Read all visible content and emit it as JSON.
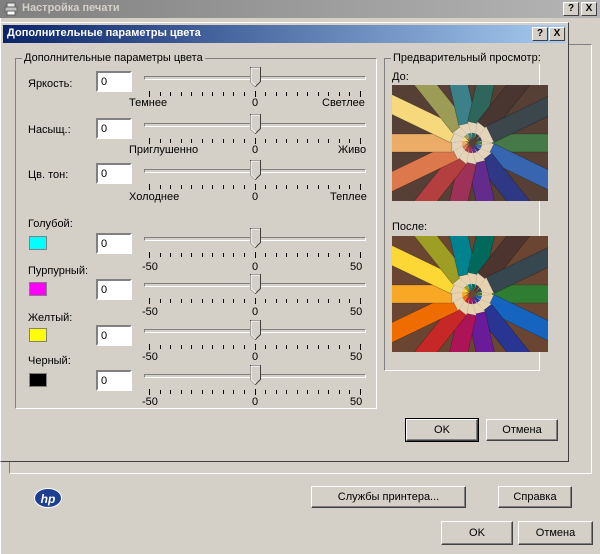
{
  "outer_window": {
    "title": "Настройка печати",
    "help_btn": "?",
    "close_btn": "X",
    "services_button": "Службы принтера...",
    "help_button": "Справка",
    "ok_button": "OK",
    "cancel_button": "Отмена",
    "logo_text": "hp"
  },
  "dialog": {
    "title": "Дополнительные параметры цвета",
    "help_btn": "?",
    "close_btn": "X",
    "ok_button": "OK",
    "cancel_button": "Отмена",
    "group_title": "Дополнительные параметры цвета",
    "brightness": {
      "label": "Яркость:",
      "value": "0",
      "left": "Темнее",
      "center": "0",
      "right": "Светлее",
      "level": 0
    },
    "saturation": {
      "label": "Насыщ.:",
      "value": "0",
      "left": "Приглушенно",
      "center": "0",
      "right": "Живо",
      "level": 0
    },
    "hue": {
      "label": "Цв. тон:",
      "value": "0",
      "left": "Холоднее",
      "center": "0",
      "right": "Теплее",
      "level": 0
    },
    "cyan": {
      "label": "Голубой:",
      "value": "0",
      "left": "-50",
      "center": "0",
      "right": "50",
      "color": "#00ffff",
      "level": 0
    },
    "magenta": {
      "label": "Пурпурный:",
      "value": "0",
      "left": "-50",
      "center": "0",
      "right": "50",
      "color": "#ff00ff",
      "level": 0
    },
    "yellow": {
      "label": "Желтый:",
      "value": "0",
      "left": "-50",
      "center": "0",
      "right": "50",
      "color": "#ffff00",
      "level": 0
    },
    "black": {
      "label": "Черный:",
      "value": "0",
      "left": "-50",
      "center": "0",
      "right": "50",
      "color": "#000000",
      "level": 0
    },
    "preview": {
      "title": "Предварительный просмотр:",
      "before": "До:",
      "after": "После:"
    }
  },
  "colors": {
    "face": "#d4d0c8",
    "active_title_start": "#0a246a",
    "active_title_end": "#a6caf0",
    "inactive_title": "#808080"
  }
}
